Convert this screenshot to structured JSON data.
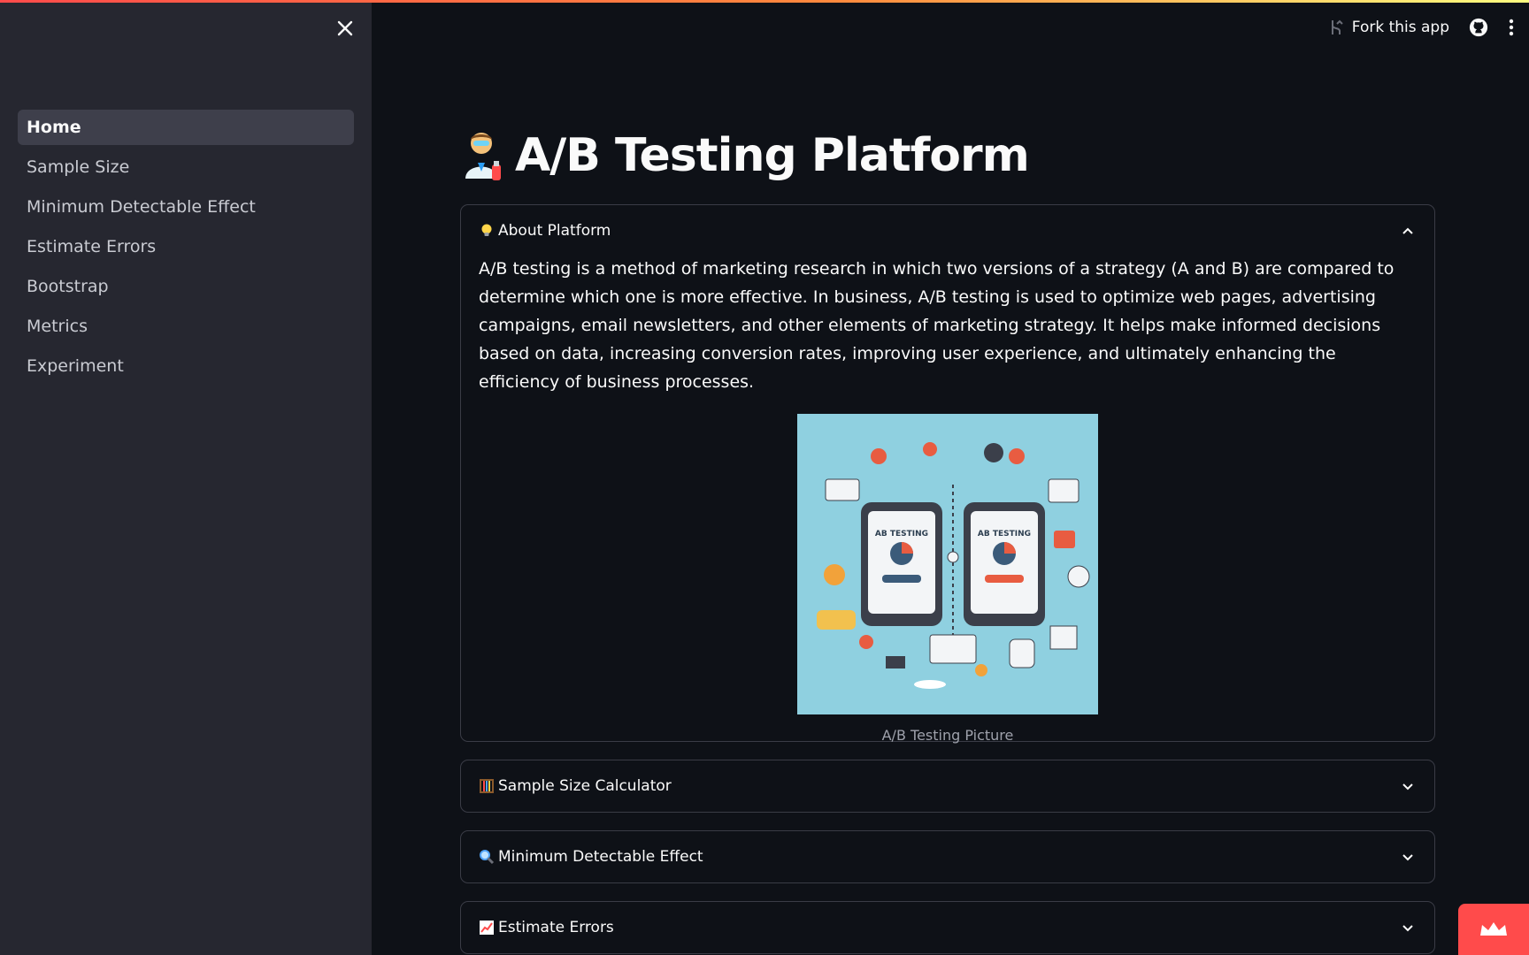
{
  "header": {
    "fork_label": "Fork this app",
    "icons": [
      "fork-icon",
      "github-icon",
      "more-vertical-icon"
    ]
  },
  "sidebar": {
    "close_icon": "close-icon",
    "items": [
      {
        "label": "Home",
        "active": true
      },
      {
        "label": "Sample Size",
        "active": false
      },
      {
        "label": "Minimum Detectable Effect",
        "active": false
      },
      {
        "label": "Estimate Errors",
        "active": false
      },
      {
        "label": "Bootstrap",
        "active": false
      },
      {
        "label": "Metrics",
        "active": false
      },
      {
        "label": "Experiment",
        "active": false
      }
    ]
  },
  "main": {
    "title_icon": "scientist-icon",
    "title": "A/B Testing Platform",
    "expanders": [
      {
        "icon": "lightbulb-icon",
        "title": "About Platform",
        "expanded": true,
        "text": "A/B testing is a method of marketing research in which two versions of a strategy (A and B) are compared to determine which one is more effective. In business, A/B testing is used to optimize web pages, advertising campaigns, email newsletters, and other elements of marketing strategy. It helps make informed decisions based on data, increasing conversion rates, improving user experience, and ultimately enhancing the efficiency of business processes.",
        "image_caption": "A/B Testing Picture",
        "image_text_left": "AB TESTING",
        "image_text_right": "AB TESTING"
      },
      {
        "icon": "abacus-icon",
        "title": "Sample Size Calculator",
        "expanded": false
      },
      {
        "icon": "magnifier-icon",
        "title": "Minimum Detectable Effect",
        "expanded": false
      },
      {
        "icon": "chart-increasing-icon",
        "title": "Estimate Errors",
        "expanded": false
      }
    ]
  },
  "badge": {
    "icon": "crown-icon"
  },
  "colors": {
    "background": "#0e1117",
    "sidebar": "#262730",
    "accent": "#ff4b4b",
    "border": "#3a3c46"
  }
}
